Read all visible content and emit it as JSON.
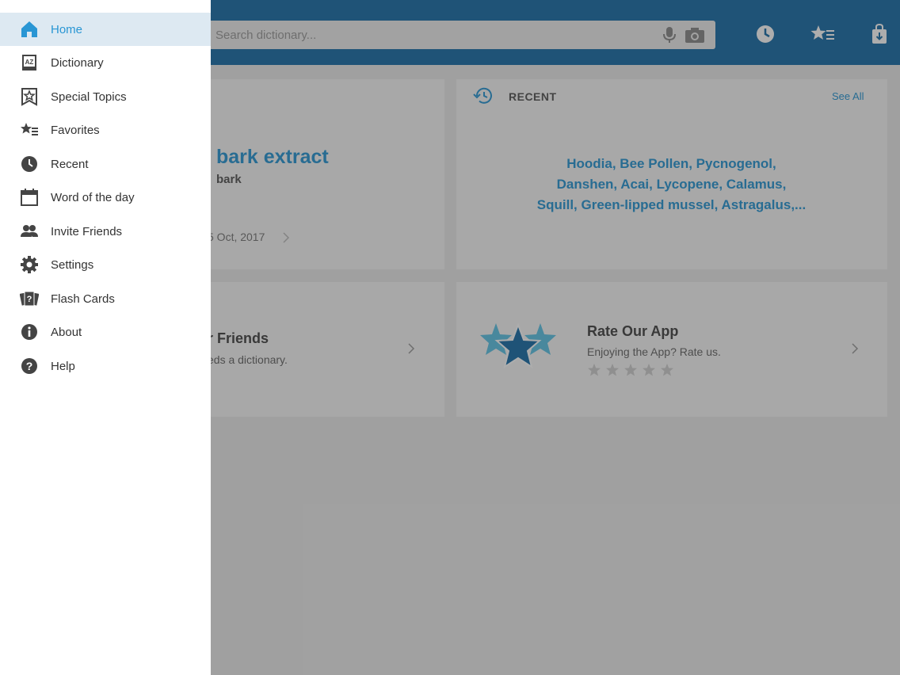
{
  "search": {
    "placeholder": "Search dictionary..."
  },
  "colors": {
    "brand": "#1a6fa8",
    "accent": "#2996d4",
    "active_bg": "#dde9f2"
  },
  "top_icons": [
    "history-clock-icon",
    "favorites-icon",
    "store-bag-icon"
  ],
  "word_of_day": {
    "title": "bark extract",
    "subtitle": "bark",
    "date": "5 Oct, 2017"
  },
  "recent": {
    "heading": "RECENT",
    "see_all": "See All",
    "words_line1": "Hoodia, Bee Pollen, Pycnogenol,",
    "words_line2": "Danshen, Acai, Lycopene, Calamus,",
    "words_line3": "Squill, Green-lipped mussel, Astragalus,..."
  },
  "invite": {
    "title": "r Friends",
    "subtitle": "eds a dictionary."
  },
  "rate": {
    "title": "Rate Our App",
    "subtitle": "Enjoying the App? Rate us.",
    "stars": 5
  },
  "menu": {
    "items": [
      {
        "label": "Home",
        "icon": "home-icon",
        "active": true
      },
      {
        "label": "Dictionary",
        "icon": "dictionary-icon"
      },
      {
        "label": "Special Topics",
        "icon": "special-topics-icon"
      },
      {
        "label": "Favorites",
        "icon": "favorites-icon"
      },
      {
        "label": "Recent",
        "icon": "clock-icon"
      },
      {
        "label": "Word of the day",
        "icon": "calendar-icon"
      },
      {
        "label": "Invite Friends",
        "icon": "people-icon"
      },
      {
        "label": "Settings",
        "icon": "gear-icon"
      },
      {
        "label": "Flash Cards",
        "icon": "flash-cards-icon"
      },
      {
        "label": "About",
        "icon": "info-icon"
      },
      {
        "label": "Help",
        "icon": "help-icon"
      }
    ]
  }
}
